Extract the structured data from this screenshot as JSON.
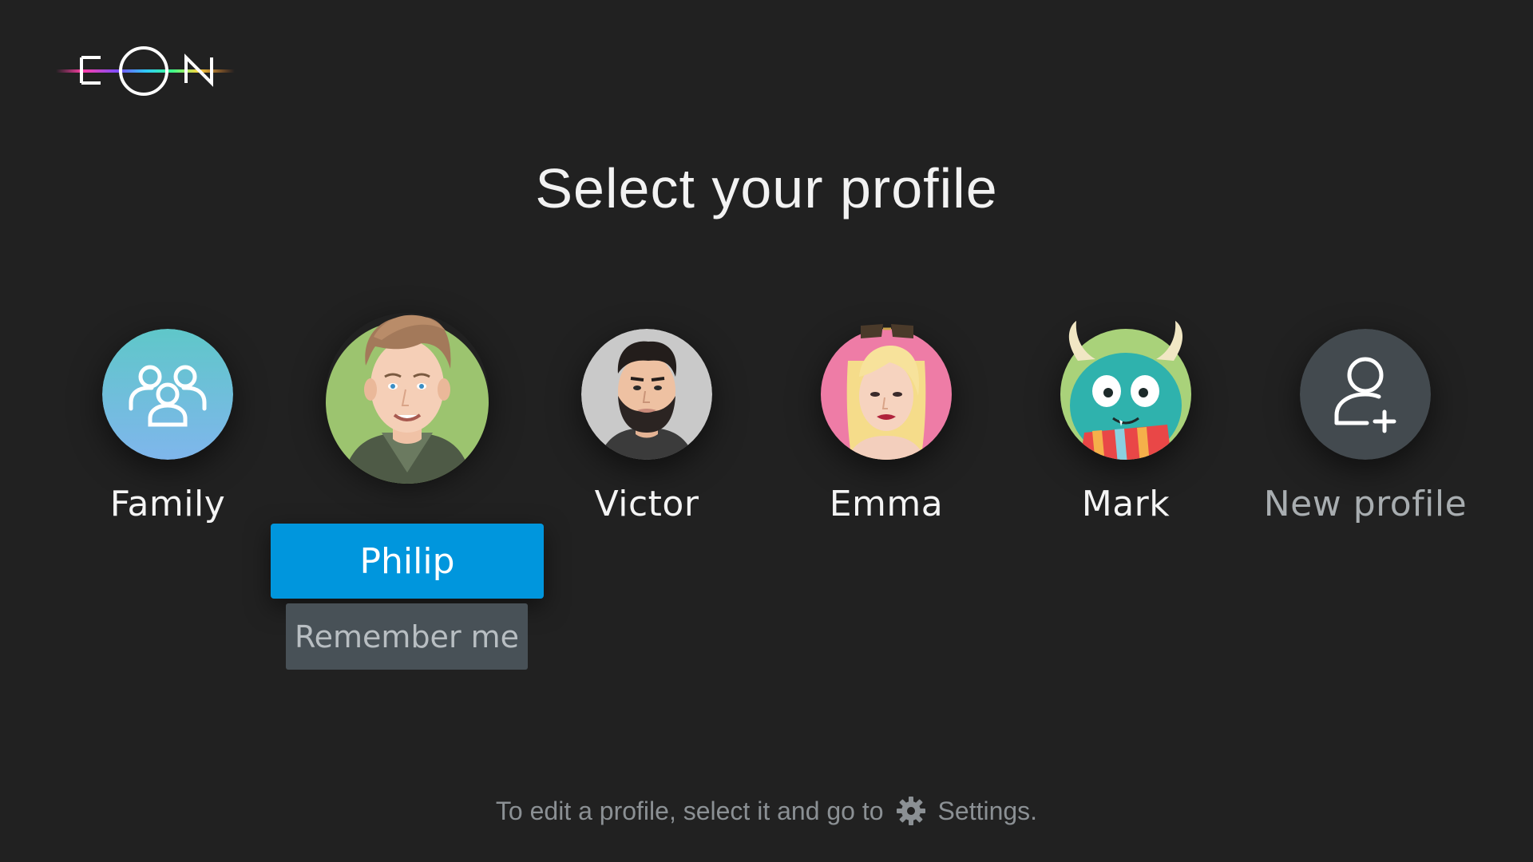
{
  "brand": {
    "logo_text": "EON",
    "accent": "#0096dd"
  },
  "title": "Select your profile",
  "profiles": [
    {
      "name": "Family",
      "icon": "family-group-icon",
      "color": "#6cc4d8"
    },
    {
      "name": "",
      "icon": "philip-avatar"
    },
    {
      "name": "Victor",
      "icon": "victor-avatar"
    },
    {
      "name": "Emma",
      "icon": "emma-avatar"
    },
    {
      "name": "Mark",
      "icon": "mark-monster-avatar"
    },
    {
      "name": "New profile",
      "icon": "add-user-icon",
      "color": "#434a4f"
    }
  ],
  "selected": {
    "name_button": "Philip",
    "remember_button": "Remember me"
  },
  "footer": {
    "hint_before": "To edit a profile, select it and go to",
    "settings_icon": "gear-icon",
    "hint_after": "Settings."
  }
}
